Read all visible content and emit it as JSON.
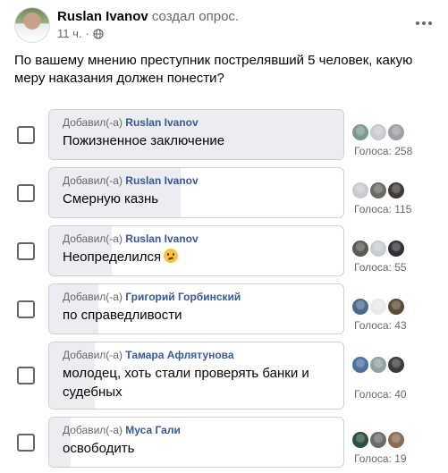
{
  "post": {
    "author": "Ruslan Ivanov",
    "action": "создал опрос.",
    "time": "11 ч.",
    "separator": "·",
    "privacy_icon": "globe-icon",
    "more_icon": "more-horizontal-icon"
  },
  "question": "По вашему мнению преступник пострелявший 5 человек, какую меру наказания должен понести?",
  "added_prefix": "Добавил(-а)",
  "options": [
    {
      "added_by": "Ruslan Ivanov",
      "text": "Пожизненное заключение",
      "emoji": "",
      "votes_label": "Голоса: 258",
      "votes": 258,
      "voter_colors": [
        "#7a9a8f",
        "#c8ccd0",
        "#9aa0a6"
      ]
    },
    {
      "added_by": "Ruslan Ivanov",
      "text": "Смерную казнь",
      "emoji": "",
      "votes_label": "Голоса: 115",
      "votes": 115,
      "voter_colors": [
        "#c8ccd0",
        "#6b6b64",
        "#3f3a36"
      ]
    },
    {
      "added_by": "Ruslan Ivanov",
      "text": "Неопределился",
      "emoji": "thinking-face-emoji-icon",
      "votes_label": "Голоса: 55",
      "votes": 55,
      "voter_colors": [
        "#555a52",
        "#c8ccd0",
        "#2f3134"
      ]
    },
    {
      "added_by": "Григорий Горбинский",
      "text": "по справедливости",
      "emoji": "",
      "votes_label": "Голоса: 43",
      "votes": 43,
      "voter_colors": [
        "#4a6a8a",
        "#e9e9e9",
        "#5a4a3a"
      ]
    },
    {
      "added_by": "Тамара Афлятунова",
      "text": "молодец, хоть стали проверять банки и судебных",
      "emoji": "",
      "votes_label": "Голоса: 40",
      "votes": 40,
      "voter_colors": [
        "#4d6fa0",
        "#8fa3a0",
        "#3b3b3b"
      ]
    },
    {
      "added_by": "Муса Гали",
      "text": "освободить",
      "emoji": "",
      "votes_label": "Голоса: 19",
      "votes": 19,
      "voter_colors": [
        "#2a4f3a",
        "#6a6a6a",
        "#8a6a50"
      ]
    }
  ],
  "colors": {
    "vote_fill": "#ebedf0",
    "link": "#385898",
    "secondary_text": "#65676b"
  }
}
